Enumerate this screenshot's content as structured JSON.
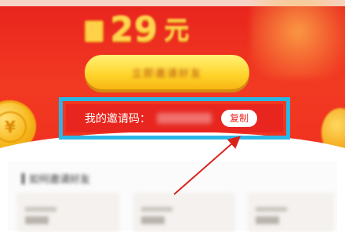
{
  "banner": {
    "amount_value": "29",
    "amount_unit": "元",
    "cta_label": "立即邀请好友"
  },
  "invite": {
    "label": "我的邀请码：",
    "copy_label": "复制"
  },
  "card": {
    "title": "如何邀请好友"
  },
  "colors": {
    "banner_red": "#e8231d",
    "highlight_blue": "#2cb6e6",
    "arrow_red": "#d9231a",
    "gold": "#ffd54f"
  },
  "icons": [
    "coin-icon",
    "arrow-annotation-icon"
  ]
}
